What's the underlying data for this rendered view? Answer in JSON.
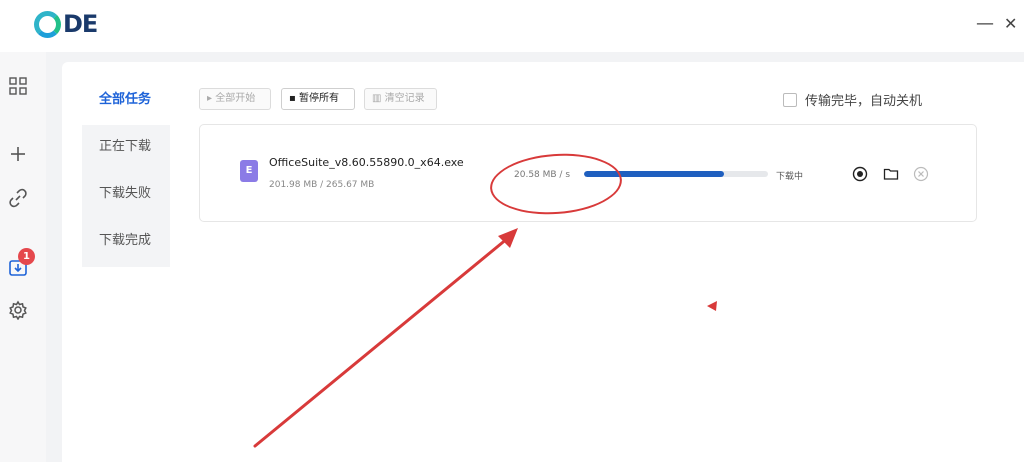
{
  "app": {
    "logo_text": "DE",
    "minimize_glyph": "—",
    "close_glyph": "✕"
  },
  "rail": {
    "icons": [
      "grid-icon",
      "plus-icon",
      "link-icon",
      "download-icon",
      "gear-icon"
    ],
    "badge_count": "1"
  },
  "categories": [
    {
      "label": "全部任务",
      "active": true
    },
    {
      "label": "正在下载",
      "active": false
    },
    {
      "label": "下载失败",
      "active": false
    },
    {
      "label": "下载完成",
      "active": false
    }
  ],
  "toolbar": {
    "start_all": "▸ 全部开始",
    "pause_all": "▪ 暂停所有",
    "clear_records": "▥ 清空记录"
  },
  "auto_shutdown_label": "传输完毕，自动关机",
  "task": {
    "file_icon_letter": "E",
    "file_name": "OfficeSuite_v8.60.55890.0_x64.exe",
    "file_size": "201.98 MB / 265.67 MB",
    "speed": "20.58 MB / s",
    "progress_fraction": 0.76,
    "status": "下载中",
    "actions": [
      "pause-icon",
      "folder-icon",
      "cancel-icon"
    ]
  },
  "colors": {
    "accent": "#1e63d8",
    "progress": "#1f5fbf",
    "badge": "#e5484d",
    "annotation": "#d83a3a"
  }
}
